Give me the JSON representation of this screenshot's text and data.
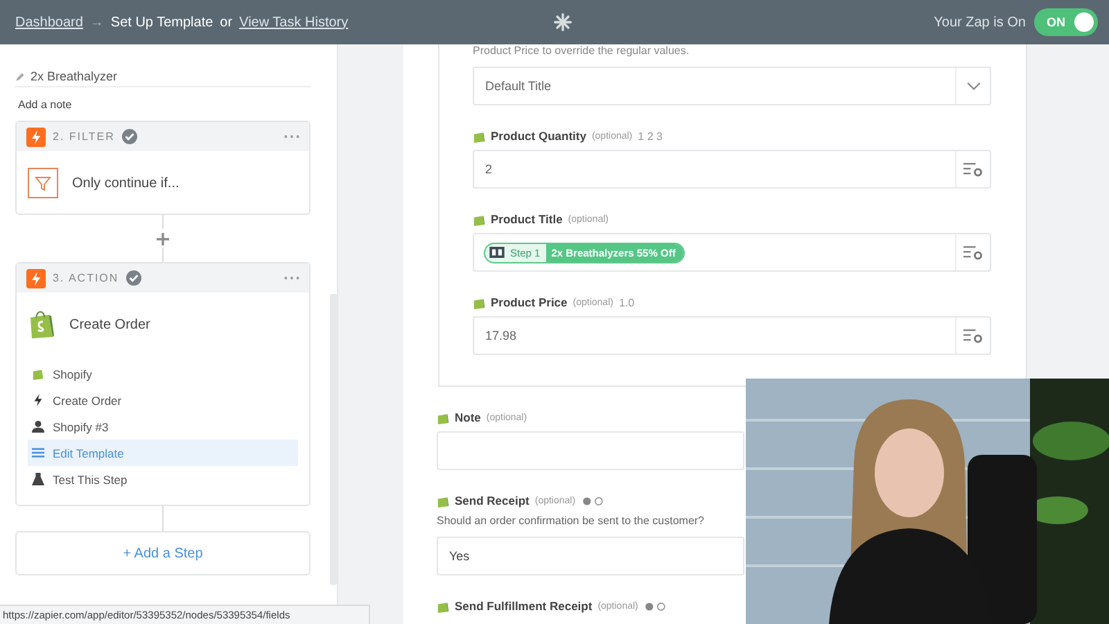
{
  "topbar": {
    "breadcrumb": [
      {
        "kind": "link",
        "text": "Dashboard"
      },
      {
        "kind": "arrow",
        "text": "→"
      },
      {
        "kind": "current",
        "text": "Set Up Template"
      },
      {
        "kind": "plain",
        "text": "or"
      },
      {
        "kind": "link",
        "text": "View Task History"
      }
    ],
    "status_label": "Your Zap is On",
    "toggle": {
      "label": "ON",
      "on": true
    }
  },
  "sidebar": {
    "title": "2x Breathalyzer",
    "note_link": "Add a note",
    "steps": [
      {
        "header": "2. FILTER",
        "complete": true,
        "kind": "filter",
        "title": "Only continue if..."
      },
      {
        "header": "3. ACTION",
        "complete": true,
        "kind": "shopify",
        "title": "Create Order",
        "items": [
          {
            "kind": "shopify",
            "label": "Shopify",
            "selected": false
          },
          {
            "kind": "bolt",
            "label": "Create Order",
            "selected": false
          },
          {
            "kind": "user",
            "label": "Shopify #3",
            "selected": false
          },
          {
            "kind": "lines",
            "label": "Edit Template",
            "selected": true
          },
          {
            "kind": "flask",
            "label": "Test This Step",
            "selected": false
          }
        ]
      }
    ],
    "add_step": "+ Add a Step"
  },
  "form": {
    "intro": "Product Price to override the regular values.",
    "card_fields": [
      {
        "kind": "select",
        "value": "Default Title"
      },
      {
        "kind": "text",
        "label": "Product Quantity",
        "hint": "(optional)",
        "extra": "1 2 3",
        "value": "2"
      },
      {
        "kind": "pill",
        "label": "Product Title",
        "hint": "(optional)",
        "pill_step": "Step 1",
        "pill_text": "2x Breathalyzers 55% Off"
      },
      {
        "kind": "text",
        "label": "Product Price",
        "hint": "(optional)",
        "extra": "1.0",
        "value": "17.98"
      }
    ],
    "fields": [
      {
        "kind": "text",
        "label": "Note",
        "hint": "(optional)",
        "toggle_dots": false
      },
      {
        "kind": "choice",
        "label": "Send Receipt",
        "hint": "(optional)",
        "toggle_dots": true,
        "description": "Should an order confirmation be sent to the customer?",
        "value": "Yes"
      },
      {
        "kind": "heading",
        "label": "Send Fulfillment Receipt",
        "hint": "(optional)",
        "toggle_dots": true
      }
    ]
  },
  "status_url": "https://zapier.com/app/editor/53395352/nodes/53395354/fields"
}
